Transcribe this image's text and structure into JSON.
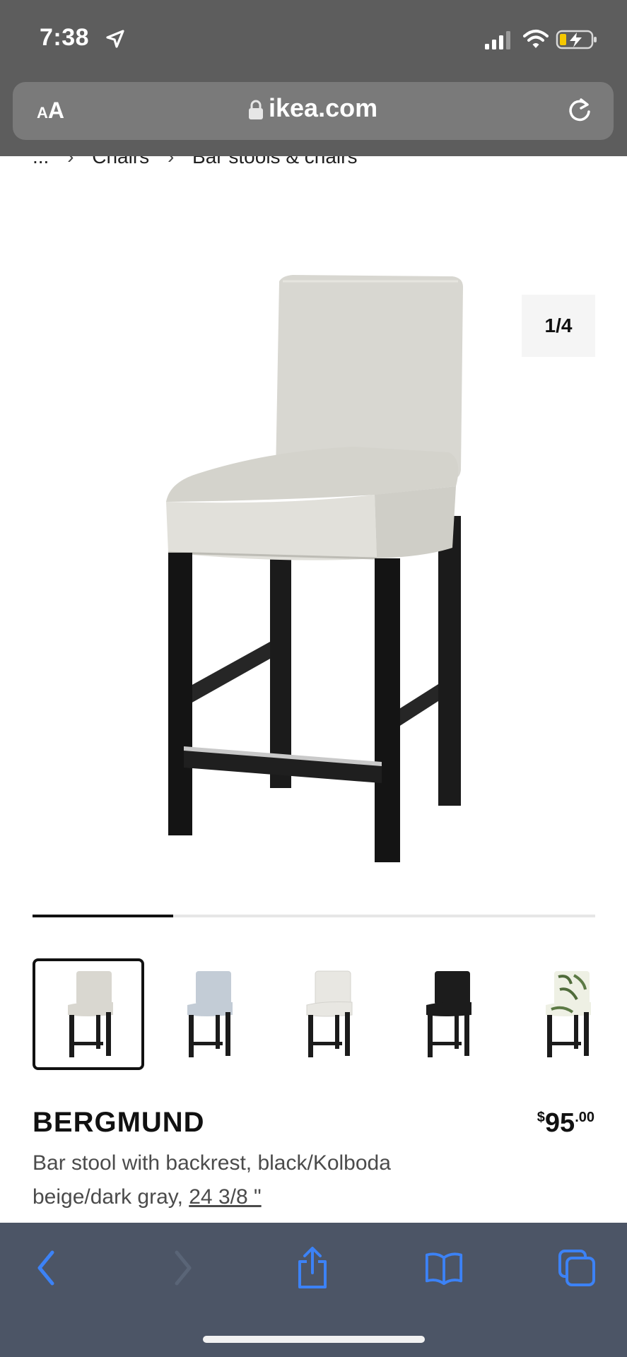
{
  "status_bar": {
    "time": "7:38"
  },
  "url_bar": {
    "text_size_label_small": "A",
    "text_size_label_large": "A",
    "domain": "ikea.com"
  },
  "breadcrumb": {
    "items": [
      "...",
      "Chairs",
      "Bar stools & chairs"
    ],
    "separator": "›"
  },
  "gallery": {
    "counter": "1/4",
    "progress_fraction": 0.25,
    "selected_index": 0
  },
  "variants": [
    {
      "color": "#d9d7d0",
      "selected": true
    },
    {
      "color": "#c3ccd6",
      "selected": false
    },
    {
      "color": "#e8e7e2",
      "selected": false
    },
    {
      "color": "#1c1c1c",
      "selected": false
    },
    {
      "color": "pattern-leaves",
      "selected": false
    }
  ],
  "product": {
    "name": "BERGMUND",
    "price_currency": "$",
    "price_integer": "95",
    "price_cents": ".00",
    "description": "Bar stool with backrest, black/Kolboda beige/dark gray, ",
    "size_link": "24 3/8 \""
  },
  "colors": {
    "chrome": "#5d5d5d",
    "toolbar": "#4c5566",
    "icon_blue": "#3c82f6",
    "seat": "#d8d7d1",
    "legs": "#1b1b1b"
  }
}
